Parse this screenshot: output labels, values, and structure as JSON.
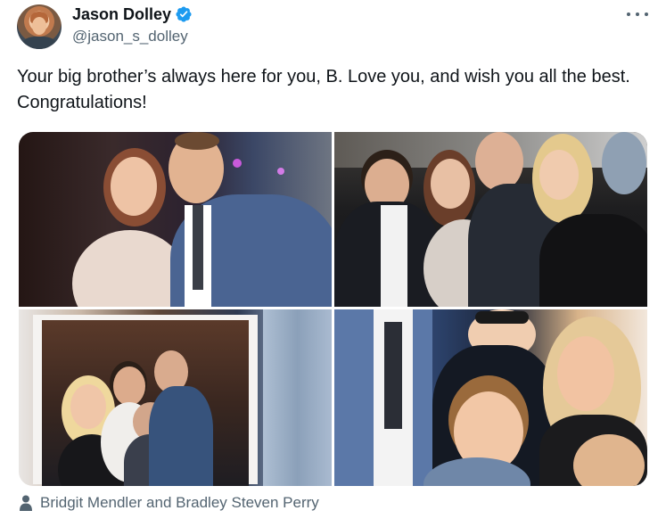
{
  "author": {
    "display_name": "Jason Dolley",
    "handle": "@jason_s_dolley",
    "verified": true
  },
  "tweet": {
    "text": "Your big brother’s always here for you, B. Love you, and wish you all the best. Congratulations!"
  },
  "media": {
    "photo_count": 4,
    "tagged_people": "Bridgit Mendler and Bradley Steven Perry"
  },
  "icons": {
    "more": "more-options-icon",
    "verified": "verified-badge-icon",
    "tag": "person-tag-icon"
  },
  "colors": {
    "text_primary": "#0f1419",
    "text_secondary": "#536471",
    "verified_blue": "#1d9bf0"
  }
}
